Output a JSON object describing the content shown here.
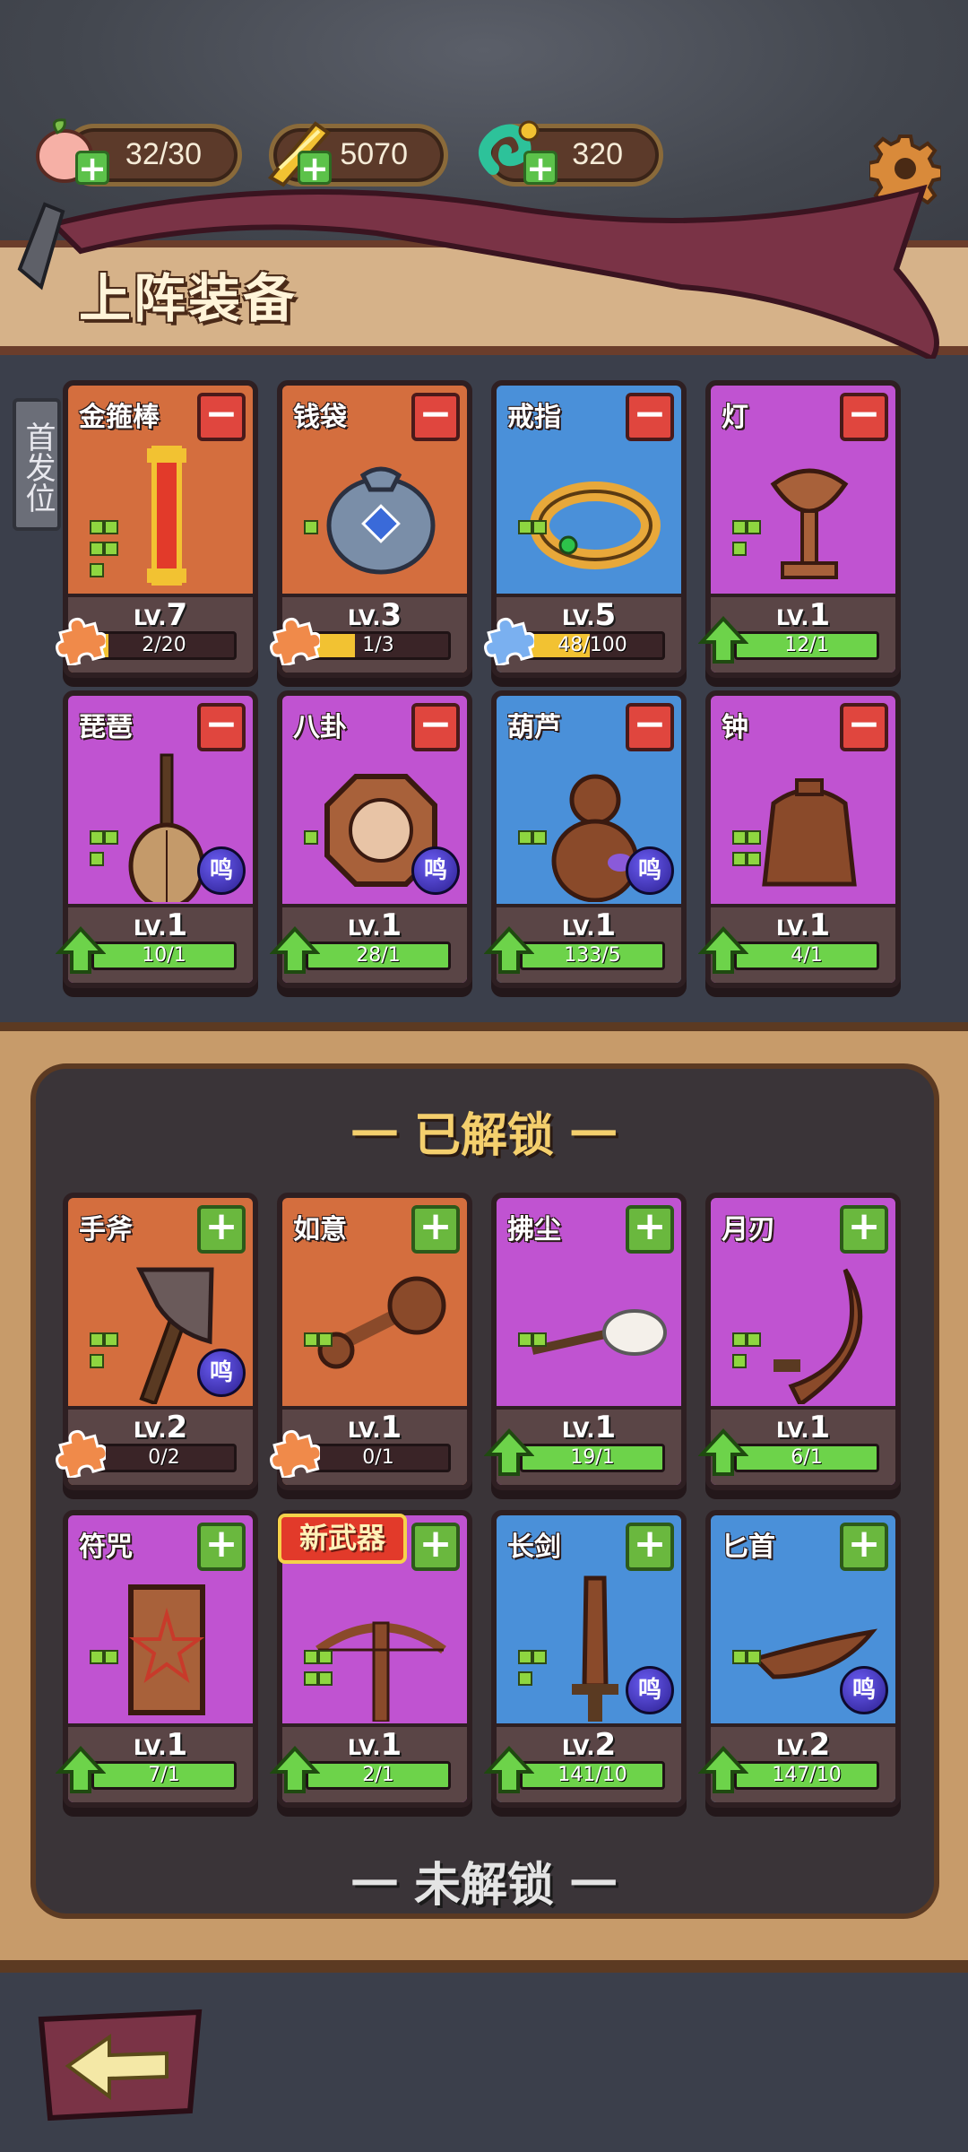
{
  "resources": [
    {
      "icon": "peach-icon",
      "value": "32/30"
    },
    {
      "icon": "gold-ingot-icon",
      "value": "5070"
    },
    {
      "icon": "jade-icon",
      "value": "320"
    }
  ],
  "header": {
    "title": "上阵装备",
    "side_tab": "首发位"
  },
  "equipped": [
    {
      "name": "金箍棒",
      "color": "orange",
      "lv_prefix": "LV.",
      "level": "7",
      "progress": "2/20",
      "fill": 0.1,
      "fill_color": "yellow",
      "badge": "puzzle-orange"
    },
    {
      "name": "钱袋",
      "color": "orange",
      "lv_prefix": "LV.",
      "level": "3",
      "progress": "1/3",
      "fill": 0.333,
      "fill_color": "yellow",
      "badge": "puzzle-orange"
    },
    {
      "name": "戒指",
      "color": "blue",
      "lv_prefix": "LV.",
      "level": "5",
      "progress": "48/100",
      "fill": 0.48,
      "fill_color": "yellow",
      "badge": "puzzle-blue"
    },
    {
      "name": "灯",
      "color": "purple",
      "lv_prefix": "LV.",
      "level": "1",
      "progress": "12/1",
      "fill": 1,
      "fill_color": "green",
      "badge": "arrow-up"
    },
    {
      "name": "琵琶",
      "color": "purple",
      "lv_prefix": "LV.",
      "level": "1",
      "progress": "10/1",
      "fill": 1,
      "fill_color": "green",
      "badge": "arrow-up",
      "ming": "鸣"
    },
    {
      "name": "八卦",
      "color": "purple",
      "lv_prefix": "LV.",
      "level": "1",
      "progress": "28/1",
      "fill": 1,
      "fill_color": "green",
      "badge": "arrow-up",
      "ming": "鸣"
    },
    {
      "name": "葫芦",
      "color": "blue",
      "lv_prefix": "LV.",
      "level": "1",
      "progress": "133/5",
      "fill": 1,
      "fill_color": "green",
      "badge": "arrow-up",
      "ming": "鸣"
    },
    {
      "name": "钟",
      "color": "purple",
      "lv_prefix": "LV.",
      "level": "1",
      "progress": "4/1",
      "fill": 1,
      "fill_color": "green",
      "badge": "arrow-up"
    }
  ],
  "unlocked_title": "一 已解锁 一",
  "unlocked": [
    {
      "name": "手斧",
      "color": "orange",
      "lv_prefix": "LV.",
      "level": "2",
      "progress": "0/2",
      "fill": 0,
      "fill_color": "yellow",
      "badge": "puzzle-orange",
      "ming": "鸣"
    },
    {
      "name": "如意",
      "color": "orange",
      "lv_prefix": "LV.",
      "level": "1",
      "progress": "0/1",
      "fill": 0,
      "fill_color": "yellow",
      "badge": "puzzle-orange"
    },
    {
      "name": "拂尘",
      "color": "purple",
      "lv_prefix": "LV.",
      "level": "1",
      "progress": "19/1",
      "fill": 1,
      "fill_color": "green",
      "badge": "arrow-up"
    },
    {
      "name": "月刃",
      "color": "purple",
      "lv_prefix": "LV.",
      "level": "1",
      "progress": "6/1",
      "fill": 1,
      "fill_color": "green",
      "badge": "arrow-up"
    },
    {
      "name": "符咒",
      "color": "purple",
      "lv_prefix": "LV.",
      "level": "1",
      "progress": "7/1",
      "fill": 1,
      "fill_color": "green",
      "badge": "arrow-up"
    },
    {
      "name": "",
      "color": "purple",
      "lv_prefix": "LV.",
      "level": "1",
      "progress": "2/1",
      "fill": 1,
      "fill_color": "green",
      "badge": "arrow-up"
    },
    {
      "name": "长剑",
      "color": "blue",
      "lv_prefix": "LV.",
      "level": "2",
      "progress": "141/10",
      "fill": 1,
      "fill_color": "green",
      "badge": "arrow-up",
      "ming": "鸣"
    },
    {
      "name": "匕首",
      "color": "blue",
      "lv_prefix": "LV.",
      "level": "2",
      "progress": "147/10",
      "fill": 1,
      "fill_color": "green",
      "badge": "arrow-up",
      "ming": "鸣"
    }
  ],
  "new_weapon_tag": "新武器",
  "locked_title": "一 未解锁 一",
  "colors": {
    "orange": "#d46e3e",
    "purple": "#c053d1",
    "blue": "#4a90d9",
    "bar_green": "#6dd34a",
    "bar_yellow": "#f2c232"
  }
}
